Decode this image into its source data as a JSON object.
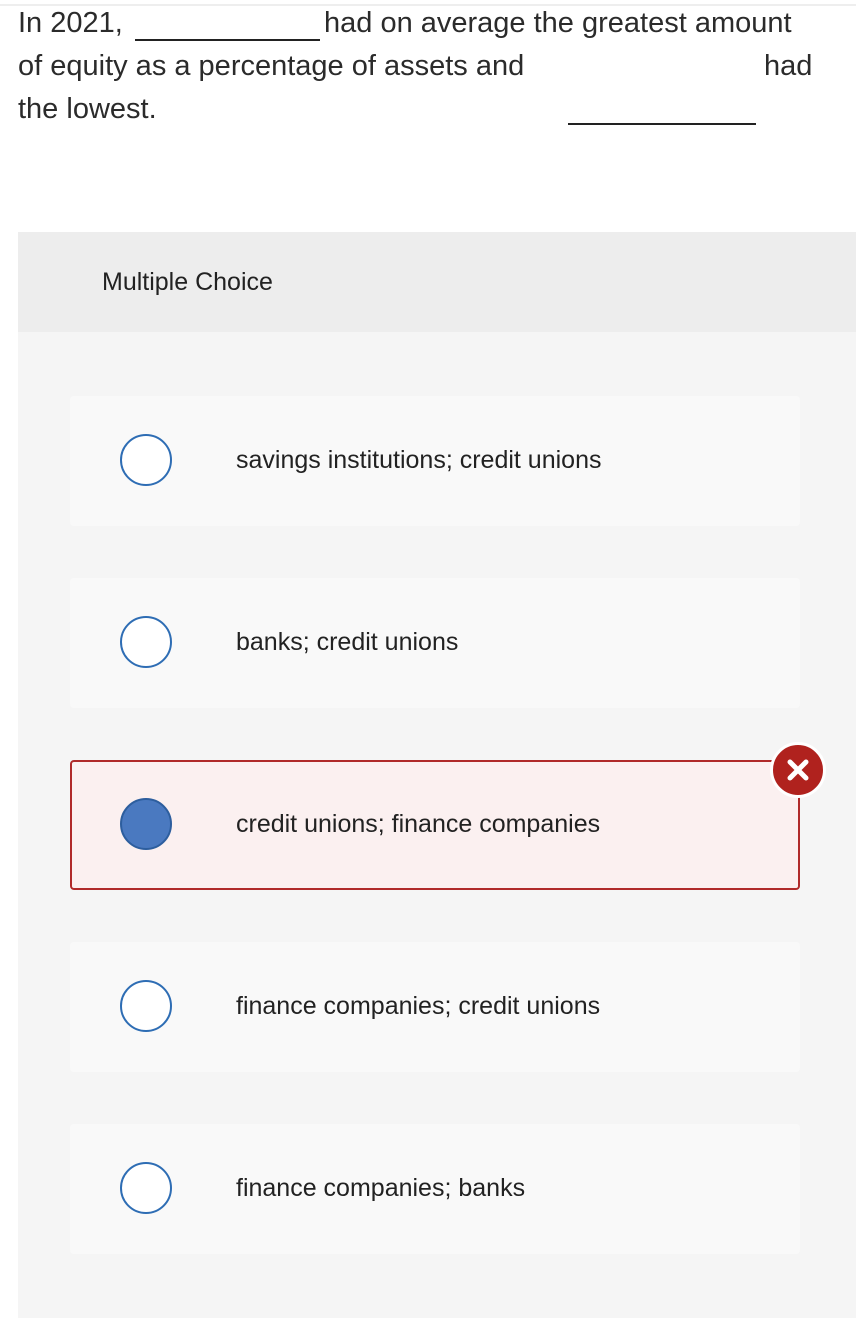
{
  "question": {
    "line1_a": "In 2021,",
    "line1_b": "had on average the greatest amount",
    "line2_a": "of equity as a percentage of assets and",
    "line2_b": "had",
    "line3": "the lowest."
  },
  "multiple_choice": {
    "title": "Multiple Choice",
    "options": [
      {
        "label": "savings institutions; credit unions",
        "selected": false
      },
      {
        "label": "banks; credit unions",
        "selected": false
      },
      {
        "label": "credit unions; finance companies",
        "selected": true,
        "status": "incorrect"
      },
      {
        "label": "finance companies; credit unions",
        "selected": false
      },
      {
        "label": "finance companies; banks",
        "selected": false
      }
    ]
  },
  "colors": {
    "radio_border": "#2e6db4",
    "radio_fill": "#4a79c0",
    "incorrect": "#b0221e",
    "incorrect_bg": "#fbf0f0",
    "panel_bg": "#f5f5f5",
    "header_bg": "#ededed",
    "option_bg": "#f9f9f9"
  },
  "icons": {
    "incorrect_badge": "close-x-icon",
    "radio_empty": "radio-unchecked-icon",
    "radio_selected": "radio-checked-icon"
  }
}
